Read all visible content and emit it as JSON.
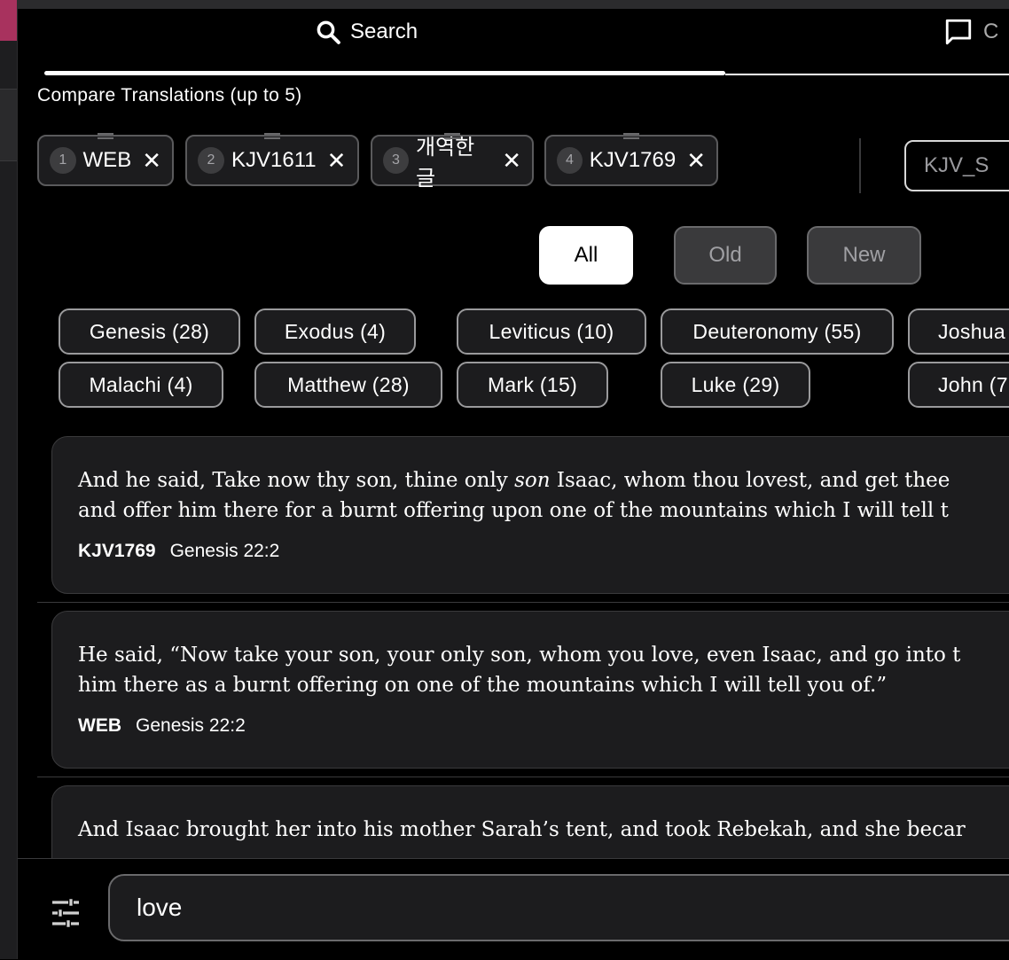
{
  "tabs": [
    {
      "label": "Search",
      "icon": "search-icon"
    },
    {
      "label": "C",
      "icon": "comment-icon"
    }
  ],
  "compare": {
    "label": "Compare Translations (up to 5)",
    "selected": [
      {
        "num": "1",
        "name": "WEB"
      },
      {
        "num": "2",
        "name": "KJV1611"
      },
      {
        "num": "3",
        "name": "개역한글"
      },
      {
        "num": "4",
        "name": "KJV1769"
      }
    ],
    "available": [
      "KJV_S"
    ]
  },
  "testament_filter": {
    "all": "All",
    "old": "Old",
    "new": "New",
    "selected": "All"
  },
  "books": [
    [
      "Genesis (28)",
      "Exodus (4)",
      "Leviticus (10)",
      "Deuteronomy (55)",
      "Joshua"
    ],
    [
      "Malachi (4)",
      "Matthew (28)",
      "Mark (15)",
      "Luke (29)",
      "John (7"
    ]
  ],
  "results": [
    {
      "line1_a": "And he said, Take now thy son, thine only ",
      "line1_italic": "son",
      "line1_b": " Isaac, whom thou lovest, and get thee",
      "line2": "and offer him there for a burnt offering upon one of the mountains which I will tell t",
      "translation": "KJV1769",
      "reference": "Genesis 22:2"
    },
    {
      "line1": "He said, “Now take your son, your only son, whom you love, even Isaac, and go into t",
      "line2": "him there as a burnt offering on one of the mountains which I will tell you of.”",
      "translation": "WEB",
      "reference": "Genesis 22:2"
    },
    {
      "line1": "And Isaac brought her into his mother Sarah’s tent, and took Rebekah, and she becar"
    }
  ],
  "search": {
    "value": "love"
  }
}
